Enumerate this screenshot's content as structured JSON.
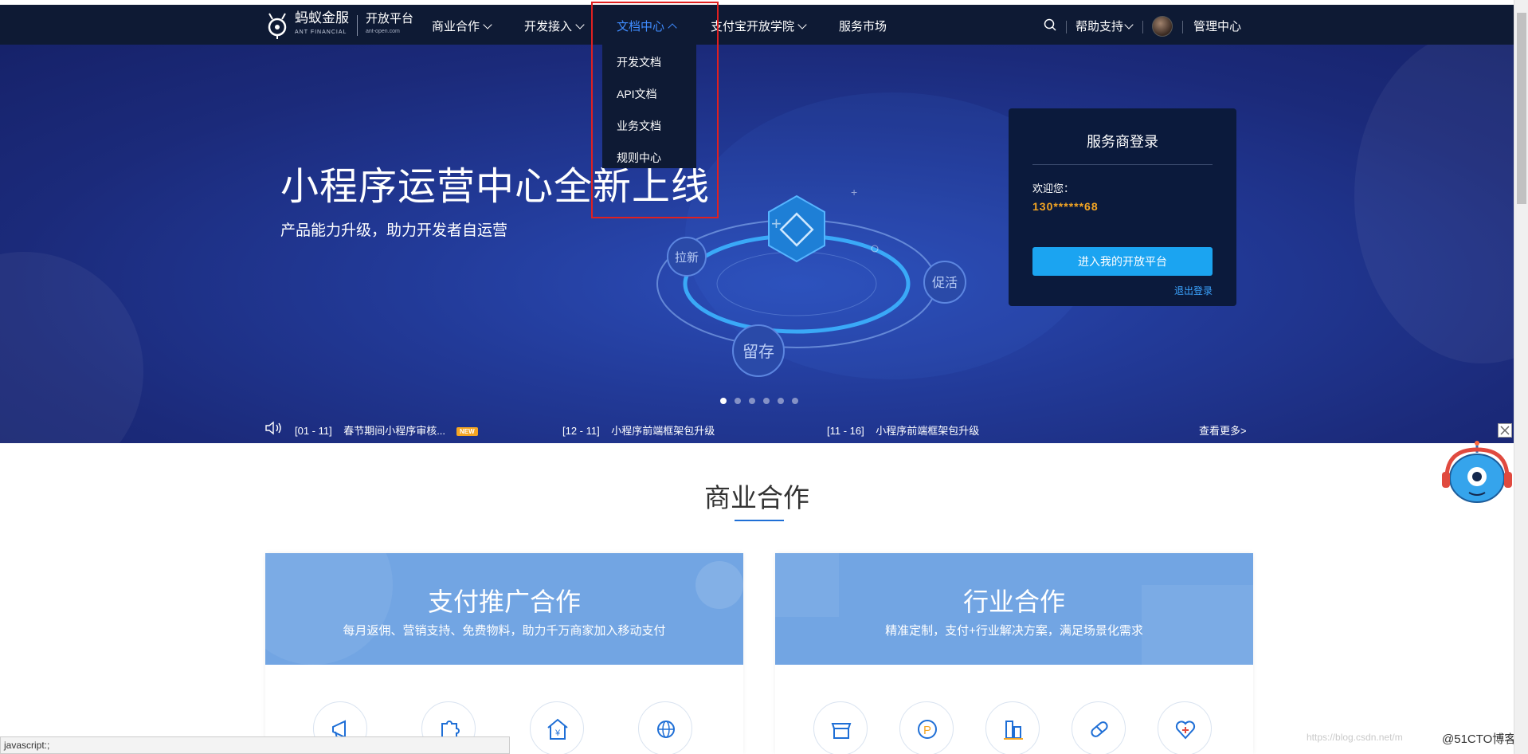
{
  "nav": {
    "brand": "蚂蚁金服",
    "brand_en": "ANT FINANCIAL",
    "platform": "开放平台",
    "platform_url": "ant-open.com",
    "items": [
      {
        "label": "商业合作"
      },
      {
        "label": "开发接入"
      },
      {
        "label": "文档中心"
      },
      {
        "label": "支付宝开放学院"
      },
      {
        "label": "服务市场"
      }
    ],
    "help": "帮助支持",
    "admin": "管理中心"
  },
  "dropdown": {
    "items": [
      "开发文档",
      "API文档",
      "业务文档",
      "规则中心"
    ]
  },
  "hero": {
    "title": "小程序运营中心全新上线",
    "subtitle": "产品能力升级，助力开发者自运营",
    "orbit_labels": [
      "拉新",
      "促活",
      "留存"
    ]
  },
  "login": {
    "title": "服务商登录",
    "welcome": "欢迎您：",
    "user": "130******68",
    "enter_button": "进入我的开放平台",
    "logout": "退出登录"
  },
  "notices": {
    "items": [
      {
        "date": "[01 - 11]",
        "text": "春节期间小程序审核..."
      },
      {
        "date": "[12 - 11]",
        "text": "小程序前端框架包升级"
      },
      {
        "date": "[11 - 16]",
        "text": "小程序前端框架包升级"
      }
    ],
    "badge": "NEW",
    "more": "查看更多>"
  },
  "section": {
    "title": "商业合作",
    "cards": [
      {
        "title": "支付推广合作",
        "subtitle": "每月返佣、营销支持、免费物料，助力千万商家加入移动支付"
      },
      {
        "title": "行业合作",
        "subtitle": "精准定制，支付+行业解决方案，满足场景化需求"
      }
    ]
  },
  "status_bar": "javascript:;",
  "watermark": "https://blog.csdn.net/m",
  "watermark2": "@51CTO博客",
  "colors": {
    "nav_bg": "#0e1a34",
    "accent": "#3f8cff",
    "button": "#1ba4f1",
    "user": "#f5a623"
  }
}
